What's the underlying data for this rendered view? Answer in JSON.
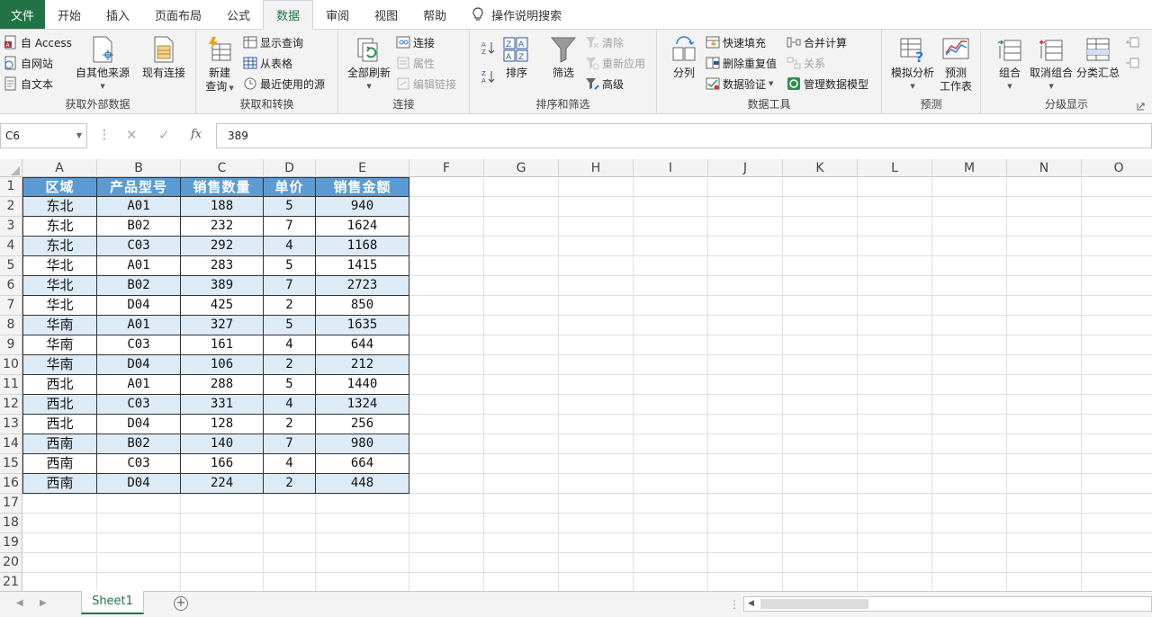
{
  "menu": {
    "tabs": [
      "文件",
      "开始",
      "插入",
      "页面布局",
      "公式",
      "数据",
      "审阅",
      "视图",
      "帮助"
    ],
    "active": "数据",
    "tell_me": "操作说明搜索"
  },
  "ribbon": {
    "get_external": {
      "label": "获取外部数据",
      "access": "自 Access",
      "web": "自网站",
      "text": "自文本",
      "other": "自其他来源",
      "existing": "现有连接"
    },
    "get_transform": {
      "label": "获取和转换",
      "new_query_1": "新建",
      "new_query_2": "查询",
      "show_queries": "显示查询",
      "from_table": "从表格",
      "recent_sources": "最近使用的源"
    },
    "connections": {
      "label": "连接",
      "refresh_all": "全部刷新",
      "connections": "连接",
      "properties": "属性",
      "edit_links": "编辑链接"
    },
    "sort_filter": {
      "label": "排序和筛选",
      "sort": "排序",
      "filter": "筛选",
      "clear": "清除",
      "reapply": "重新应用",
      "advanced": "高级"
    },
    "data_tools": {
      "label": "数据工具",
      "text_to_columns": "分列",
      "flash_fill": "快速填充",
      "remove_duplicates": "删除重复值",
      "validation": "数据验证",
      "consolidate": "合并计算",
      "relationships": "关系",
      "manage_model": "管理数据模型"
    },
    "forecast": {
      "label": "预测",
      "what_if": "模拟分析",
      "forecast_sheet_1": "预测",
      "forecast_sheet_2": "工作表"
    },
    "outline": {
      "label": "分级显示",
      "group": "组合",
      "ungroup": "取消组合",
      "subtotal": "分类汇总"
    }
  },
  "formula": {
    "name_box": "C6",
    "value": "389"
  },
  "columns": [
    "A",
    "B",
    "C",
    "D",
    "E",
    "F",
    "G",
    "H",
    "I",
    "J",
    "K",
    "L",
    "M",
    "N",
    "O"
  ],
  "rows": [
    "1",
    "2",
    "3",
    "4",
    "5",
    "6",
    "7",
    "8",
    "9",
    "10",
    "11",
    "12",
    "13",
    "14",
    "15",
    "16",
    "17",
    "18",
    "19",
    "20",
    "21"
  ],
  "table": {
    "headers": [
      "区域",
      "产品型号",
      "销售数量",
      "单价",
      "销售金额"
    ],
    "rows": [
      [
        "东北",
        "A01",
        "188",
        "5",
        "940"
      ],
      [
        "东北",
        "B02",
        "232",
        "7",
        "1624"
      ],
      [
        "东北",
        "C03",
        "292",
        "4",
        "1168"
      ],
      [
        "华北",
        "A01",
        "283",
        "5",
        "1415"
      ],
      [
        "华北",
        "B02",
        "389",
        "7",
        "2723"
      ],
      [
        "华北",
        "D04",
        "425",
        "2",
        "850"
      ],
      [
        "华南",
        "A01",
        "327",
        "5",
        "1635"
      ],
      [
        "华南",
        "C03",
        "161",
        "4",
        "644"
      ],
      [
        "华南",
        "D04",
        "106",
        "2",
        "212"
      ],
      [
        "西北",
        "A01",
        "288",
        "5",
        "1440"
      ],
      [
        "西北",
        "C03",
        "331",
        "4",
        "1324"
      ],
      [
        "西北",
        "D04",
        "128",
        "2",
        "256"
      ],
      [
        "西南",
        "B02",
        "140",
        "7",
        "980"
      ],
      [
        "西南",
        "C03",
        "166",
        "4",
        "664"
      ],
      [
        "西南",
        "D04",
        "224",
        "2",
        "448"
      ]
    ]
  },
  "sheets": {
    "active": "Sheet1"
  },
  "colors": {
    "excel_green": "#217346",
    "header_fill": "#5b9bd5",
    "band_fill": "#ddebf7"
  }
}
